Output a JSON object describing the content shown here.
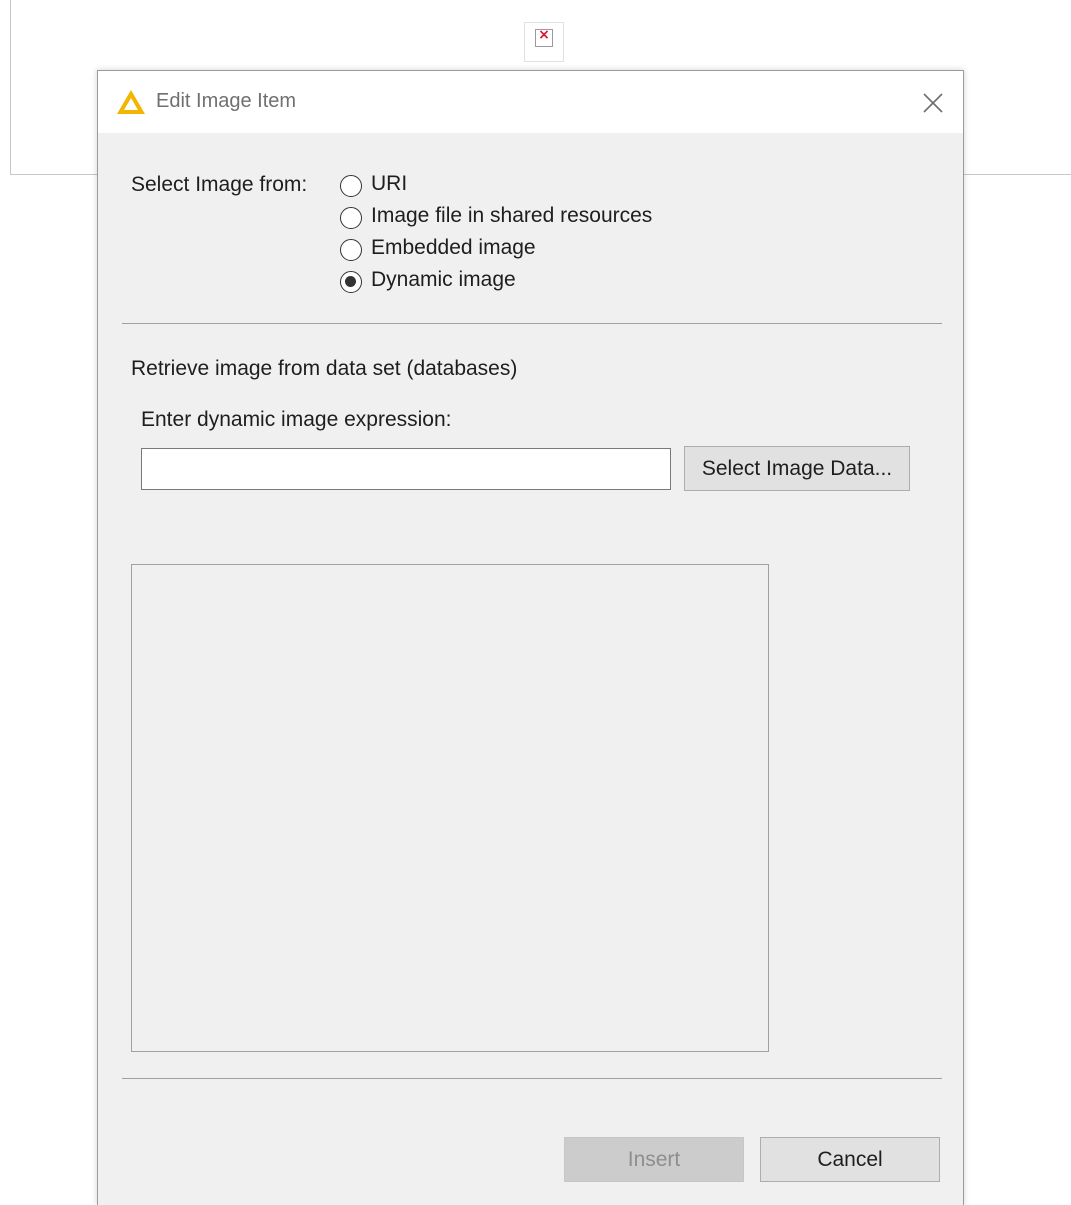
{
  "dialog": {
    "title": "Edit Image Item",
    "icon": "warning-triangle-icon",
    "icon_color": "#f2b600",
    "close_icon": "close-icon"
  },
  "image_source": {
    "label": "Select Image from:",
    "options": [
      {
        "label": "URI",
        "selected": false
      },
      {
        "label": "Image file in shared resources",
        "selected": false
      },
      {
        "label": "Embedded image",
        "selected": false
      },
      {
        "label": "Dynamic image",
        "selected": true
      }
    ]
  },
  "dynamic": {
    "section_title": "Retrieve image from data set (databases)",
    "expression_label": "Enter dynamic image expression:",
    "expression_value": "",
    "select_button_label": "Select Image Data..."
  },
  "footer": {
    "insert_label": "Insert",
    "insert_enabled": false,
    "cancel_label": "Cancel"
  },
  "background": {
    "broken_image_icon": "broken-image-icon"
  }
}
